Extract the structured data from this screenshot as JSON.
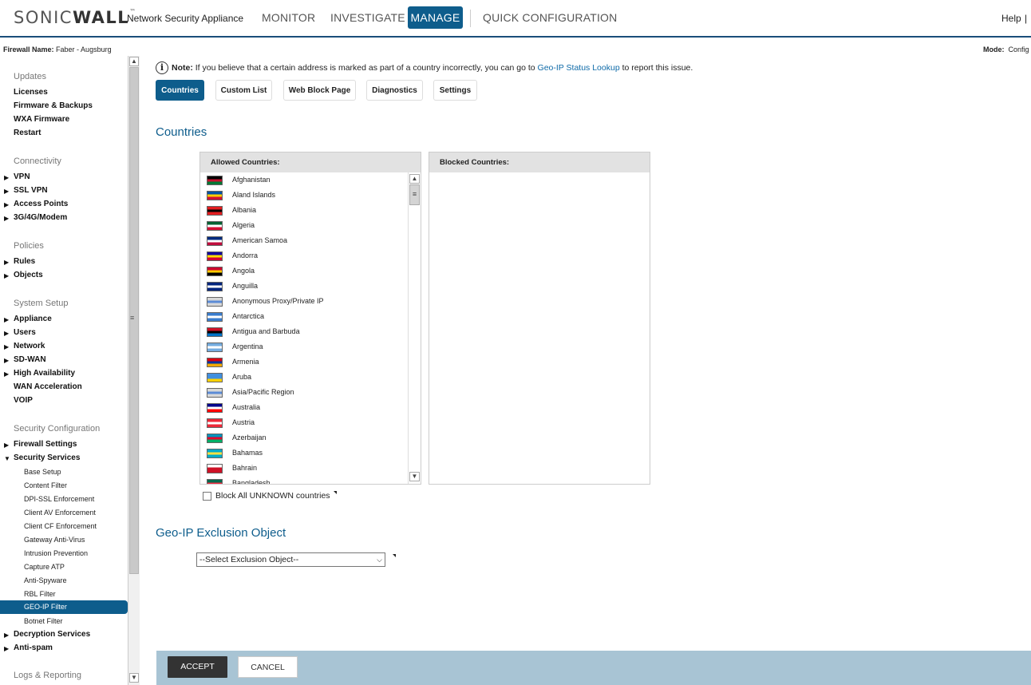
{
  "header": {
    "logo_light": "SONIC",
    "logo_bold": "WALL",
    "logo_tm": "™",
    "product": "Network Security Appliance",
    "nav": {
      "monitor": "MONITOR",
      "investigate": "INVESTIGATE",
      "manage": "MANAGE",
      "quick": "QUICK CONFIGURATION"
    },
    "help": "Help",
    "help_sep": "|",
    "accent_color": "#0e5d8c"
  },
  "infobar": {
    "firewall_label": "Firewall Name:",
    "firewall_value": "Faber - Augsburg",
    "mode_label": "Mode:",
    "mode_value": "Config"
  },
  "sidebar": {
    "updates": {
      "heading": "Updates",
      "items": [
        "Licenses",
        "Firmware & Backups",
        "WXA Firmware",
        "Restart"
      ]
    },
    "connectivity": {
      "heading": "Connectivity",
      "items": [
        "VPN",
        "SSL VPN",
        "Access Points",
        "3G/4G/Modem"
      ]
    },
    "policies": {
      "heading": "Policies",
      "items": [
        "Rules",
        "Objects"
      ]
    },
    "system_setup": {
      "heading": "System Setup",
      "items": [
        "Appliance",
        "Users",
        "Network",
        "SD-WAN",
        "High Availability",
        "WAN Acceleration",
        "VOIP"
      ]
    },
    "security_config": {
      "heading": "Security Configuration",
      "items": [
        "Firewall Settings",
        "Security Services"
      ],
      "subitems": [
        "Base Setup",
        "Content Filter",
        "DPI-SSL Enforcement",
        "Client AV Enforcement",
        "Client CF Enforcement",
        "Gateway Anti-Virus",
        "Intrusion Prevention",
        "Capture ATP",
        "Anti-Spyware",
        "RBL Filter",
        "GEO-IP Filter",
        "Botnet Filter"
      ],
      "items_after": [
        "Decryption Services",
        "Anti-spam"
      ]
    },
    "logs": {
      "heading": "Logs & Reporting"
    }
  },
  "note": {
    "label": "Note:",
    "text_before": " If you believe that a certain address is marked as part of a country incorrectly, you can go to ",
    "link": "Geo-IP Status Lookup",
    "text_after": " to report this issue."
  },
  "tabs": [
    "Countries",
    "Custom List",
    "Web Block Page",
    "Diagnostics",
    "Settings"
  ],
  "countries_section": {
    "title": "Countries",
    "allowed_header": "Allowed Countries:",
    "blocked_header": "Blocked Countries:",
    "allowed": [
      {
        "name": "Afghanistan",
        "flag": [
          "#000000",
          "#c8102e",
          "#007a36"
        ]
      },
      {
        "name": "Aland Islands",
        "flag": [
          "#0053a5",
          "#ffce00",
          "#d21034"
        ]
      },
      {
        "name": "Albania",
        "flag": [
          "#e41e20",
          "#000000",
          "#e41e20"
        ]
      },
      {
        "name": "Algeria",
        "flag": [
          "#006233",
          "#ffffff",
          "#d21034"
        ]
      },
      {
        "name": "American Samoa",
        "flag": [
          "#002b7f",
          "#ffffff",
          "#bf0d3e"
        ]
      },
      {
        "name": "Andorra",
        "flag": [
          "#10069f",
          "#fedf00",
          "#d50032"
        ]
      },
      {
        "name": "Angola",
        "flag": [
          "#cc092f",
          "#ffcb00",
          "#000000"
        ]
      },
      {
        "name": "Anguilla",
        "flag": [
          "#00247d",
          "#ffffff",
          "#00247d"
        ]
      },
      {
        "name": "Anonymous Proxy/Private IP",
        "flag": [
          "#d8d8d8",
          "#5b8bd6",
          "#d8d8d8"
        ]
      },
      {
        "name": "Antarctica",
        "flag": [
          "#3a7dce",
          "#ffffff",
          "#3a7dce"
        ]
      },
      {
        "name": "Antigua and Barbuda",
        "flag": [
          "#ce1126",
          "#000000",
          "#0072c6"
        ]
      },
      {
        "name": "Argentina",
        "flag": [
          "#74acdf",
          "#ffffff",
          "#74acdf"
        ]
      },
      {
        "name": "Armenia",
        "flag": [
          "#d90012",
          "#0033a0",
          "#f2a800"
        ]
      },
      {
        "name": "Aruba",
        "flag": [
          "#418fde",
          "#418fde",
          "#ffd100"
        ]
      },
      {
        "name": "Asia/Pacific Region",
        "flag": [
          "#d8d8d8",
          "#5b8bd6",
          "#d8d8d8"
        ]
      },
      {
        "name": "Australia",
        "flag": [
          "#00008b",
          "#ffffff",
          "#ff0000"
        ]
      },
      {
        "name": "Austria",
        "flag": [
          "#ed2939",
          "#ffffff",
          "#ed2939"
        ]
      },
      {
        "name": "Azerbaijan",
        "flag": [
          "#0092bc",
          "#e4002b",
          "#00af66"
        ]
      },
      {
        "name": "Bahamas",
        "flag": [
          "#00abc9",
          "#fae042",
          "#00abc9"
        ]
      },
      {
        "name": "Bahrain",
        "flag": [
          "#ffffff",
          "#ce1126",
          "#ce1126"
        ]
      },
      {
        "name": "Bangladesh",
        "flag": [
          "#006a4e",
          "#f42a41",
          "#006a4e"
        ]
      }
    ],
    "block_unknown_label": "Block All UNKNOWN countries"
  },
  "geoip_section": {
    "title": "Geo-IP Exclusion Object",
    "select_value": "--Select Exclusion Object--"
  },
  "footer": {
    "accept": "ACCEPT",
    "cancel": "CANCEL"
  },
  "icons": [
    "info-icon",
    "chevron-up-icon",
    "chevron-down-icon",
    "triangle-right-icon",
    "triangle-down-icon"
  ]
}
